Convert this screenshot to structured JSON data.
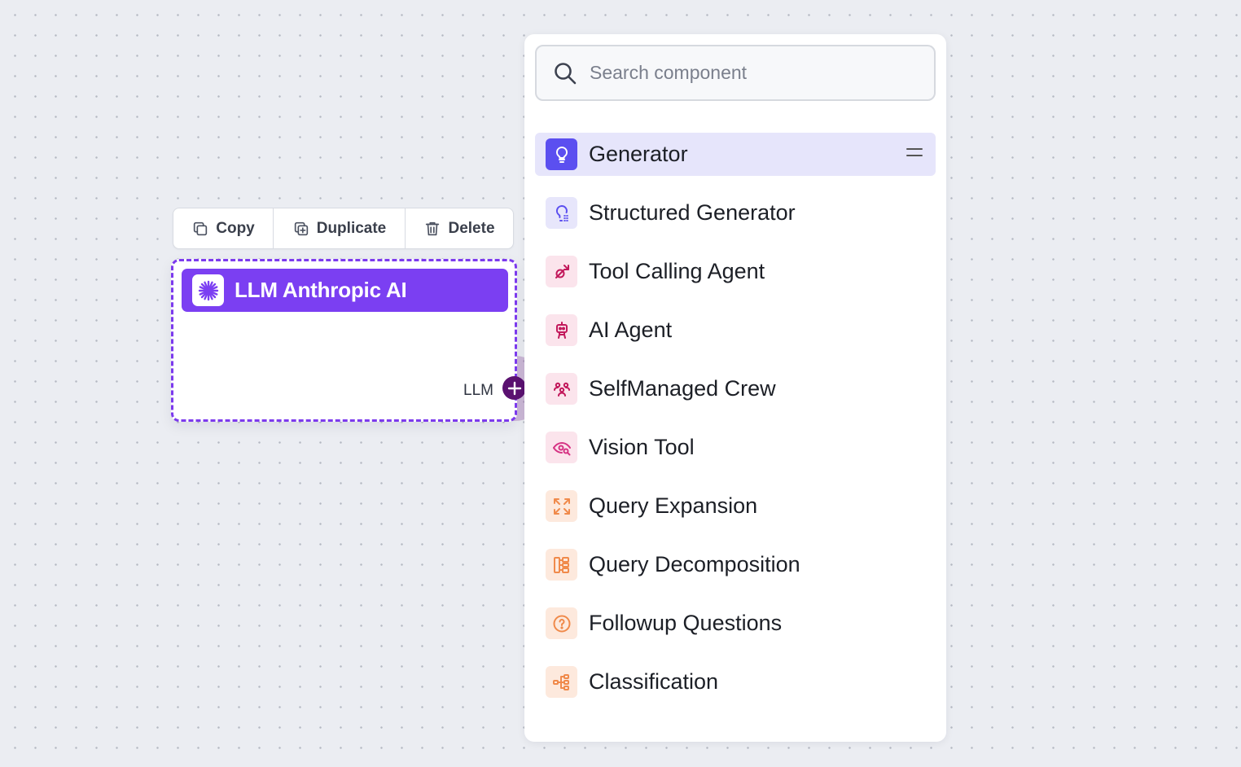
{
  "toolbar": {
    "copy_label": "Copy",
    "duplicate_label": "Duplicate",
    "delete_label": "Delete"
  },
  "node": {
    "title": "LLM Anthropic AI",
    "output_port_label": "LLM",
    "header_color": "#7b3ff2",
    "border_color": "#7c3aed"
  },
  "panel": {
    "search": {
      "placeholder": "Search component",
      "value": ""
    },
    "items": [
      {
        "label": "Generator",
        "icon": "lightbulb-icon",
        "active": true
      },
      {
        "label": "Structured Generator",
        "icon": "lightbulb-structured-icon"
      },
      {
        "label": "Tool Calling Agent",
        "icon": "tool-calling-icon"
      },
      {
        "label": "AI Agent",
        "icon": "robot-icon"
      },
      {
        "label": "SelfManaged Crew",
        "icon": "crew-icon"
      },
      {
        "label": "Vision Tool",
        "icon": "eye-search-icon"
      },
      {
        "label": "Query Expansion",
        "icon": "expand-arrows-icon"
      },
      {
        "label": "Query Decomposition",
        "icon": "decomposition-icon"
      },
      {
        "label": "Followup Questions",
        "icon": "question-circle-icon"
      },
      {
        "label": "Classification",
        "icon": "hierarchy-icon"
      }
    ]
  },
  "colors": {
    "accent_purple": "#7b3ff2",
    "active_item_bg": "#e6e5fb",
    "pink_icon": "#c2185b",
    "orange_icon": "#f08a4b"
  }
}
